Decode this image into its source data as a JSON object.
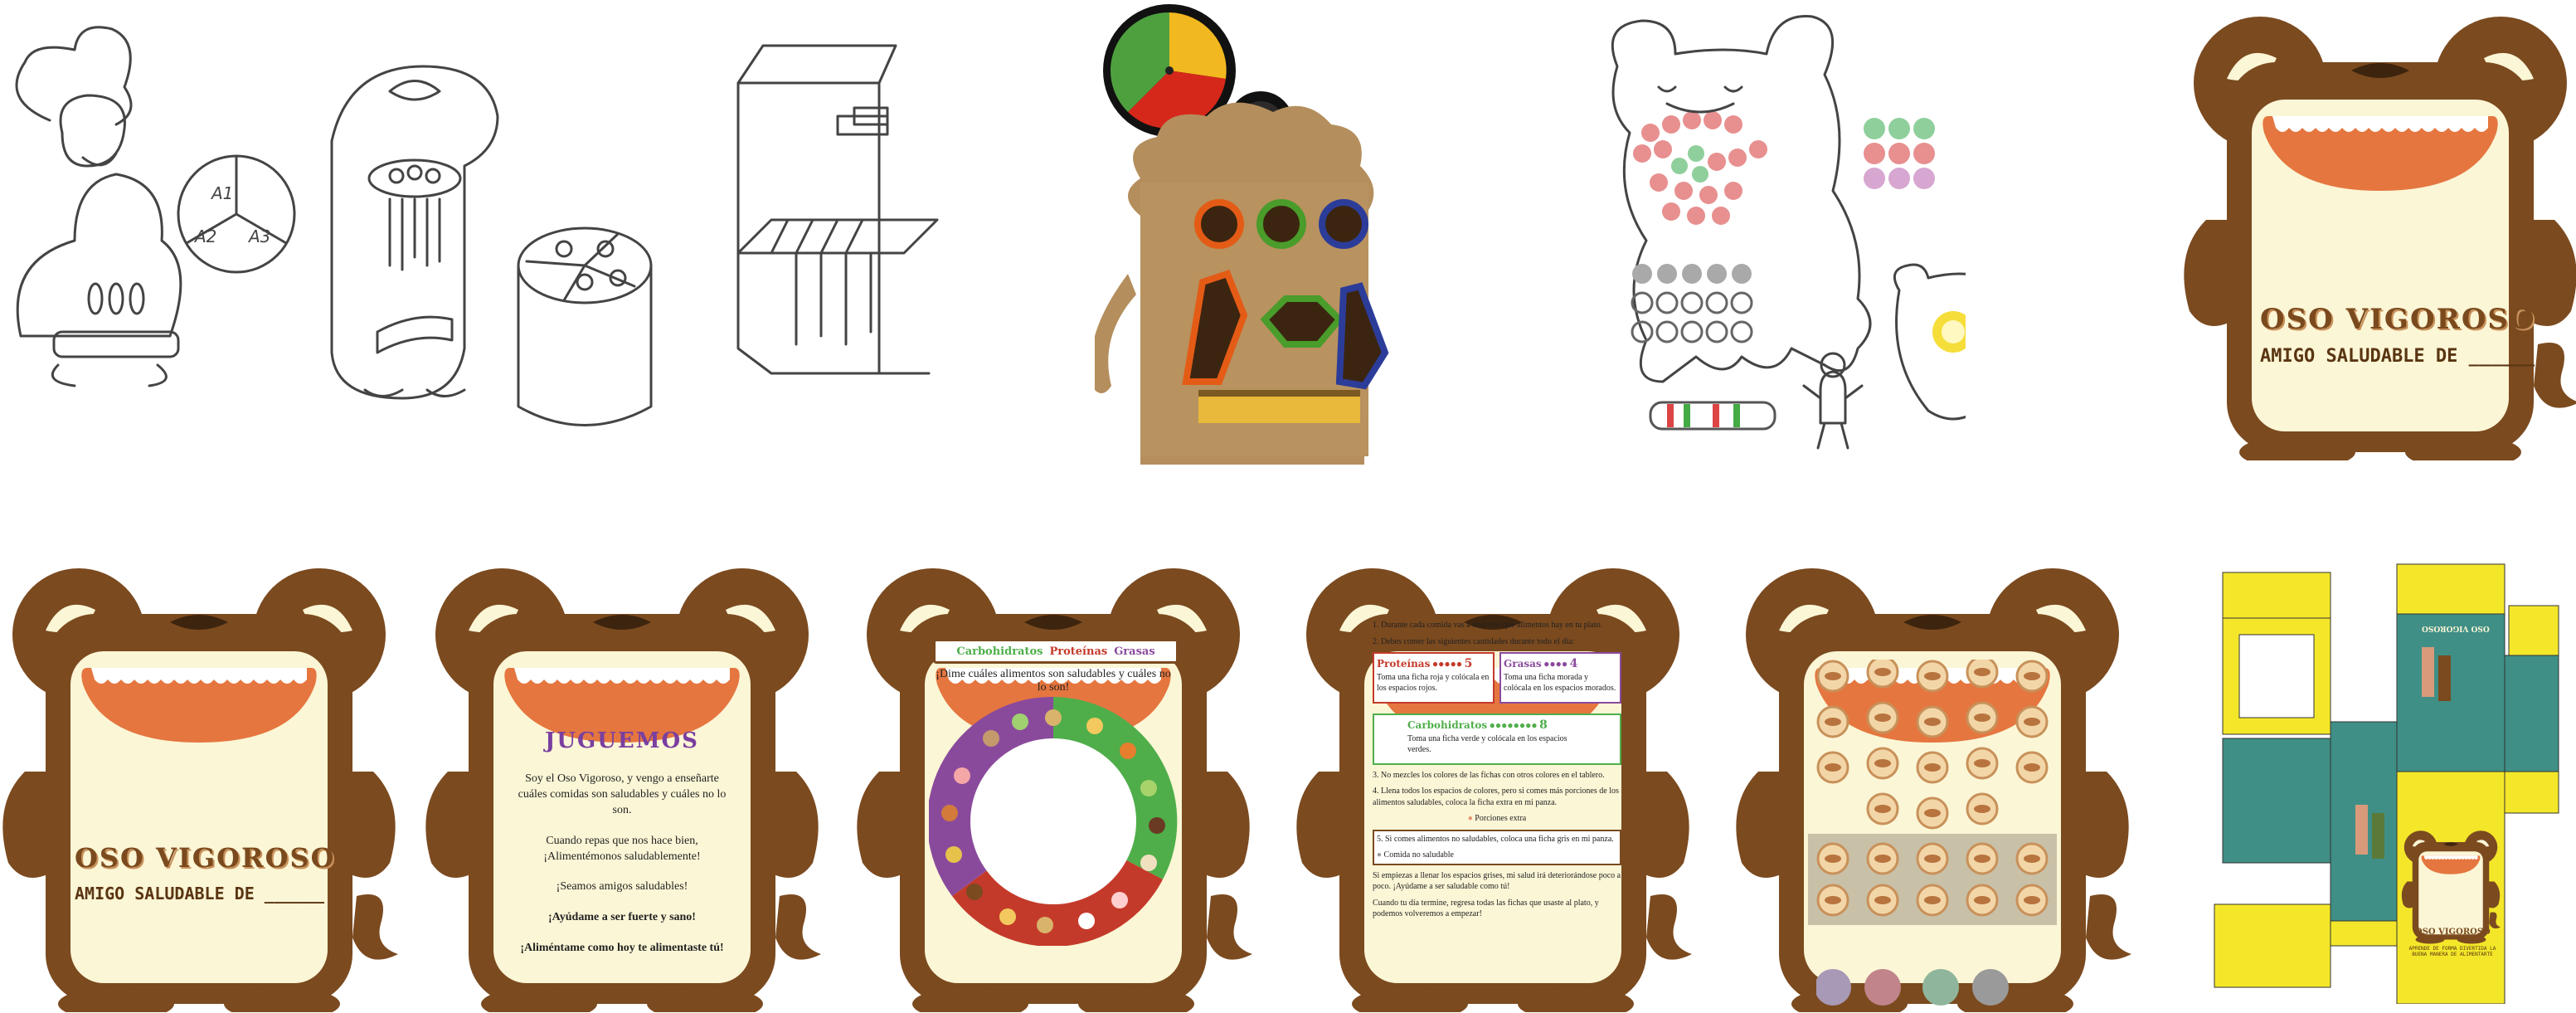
{
  "sketches": {
    "cube_labels": [
      "A1",
      "A2",
      "A3"
    ]
  },
  "cover": {
    "title": "OSO VIGOROSO",
    "subtitle": "AMIGO SALUDABLE DE ______"
  },
  "cover_small": {
    "title": "OSO VIGOROSO",
    "subtitle": "AMIGO SALUDABLE DE ______"
  },
  "juguemos": {
    "title": "JUGUEMOS",
    "p1": "Soy el Oso Vigoroso, y vengo a enseñarte cuáles comidas son saludables y cuáles no lo son.",
    "p2": "Cuando repas que nos hace bien, ¡Alimentémonos saludablemente!",
    "p3": "¡Seamos amigos saludables!",
    "p4": "¡Ayúdame a ser fuerte y sano!",
    "p5": "¡Aliméntame como hoy te alimentaste tú!"
  },
  "wheel": {
    "header_carb": "Carbohidratos",
    "header_prot": "Proteínas",
    "header_fat": "Grasas",
    "question": "¡Dime cuáles alimentos son saludables y cuáles no lo son!"
  },
  "instructions": {
    "step1": "1. Durante cada comida vas a observar que alimentos hay en tu plato.",
    "step2": "2. Debes comer las siguientes cantidades durante todo el día:",
    "proteinas_label": "Proteínas",
    "proteinas_count": "5",
    "proteinas_text": "Toma una ficha roja y colócala en los espacios rojos.",
    "grasas_label": "Grasas",
    "grasas_count": "4",
    "grasas_text": "Toma una ficha morada y colócala en los espacios morados.",
    "carb_label": "Carbohidratos",
    "carb_count": "8",
    "carb_text": "Toma una ficha verde y colócala en los espacios verdes.",
    "step3": "3. No mezcles los colores de las fichas con otros colores en el tablero.",
    "step4": "4. Llena todos los espacios de colores, pero si comes más porciones de los alimentos saludables, coloca la ficha extra en mi panza.",
    "porciones_extra": "Porciones extra",
    "step5": "5. Si comes alimentos no saludables, coloca una ficha gris en mi panza.",
    "comida_no_saludable": "Comida no saludable",
    "footer1": "Si empiezas a llenar los espacios grises, mi salud irá deteriorándose poco a poco. ¡Ayúdame a ser saludable como tú!",
    "footer2": "Cuando tu día termine, regresa todas las fichas que usaste al plato, y podemos volveremos a empezar!"
  },
  "box_template": {
    "title": "OSO VIGOROSO",
    "subtitle": "APRENDE DE FORMA DIVERTIDA LA BUENA MANERA DE ALIMENTARTE",
    "side_text": "OSO VIGOROSO"
  },
  "colors": {
    "bear_brown": "#7b4a1f",
    "belly_cream": "#fbf6d6",
    "mouth_orange": "#e5763f",
    "carb_green": "#4fae4a",
    "prot_red": "#c43a2a",
    "fat_purple": "#8a4a9c",
    "chip_purple": "#a899b6",
    "chip_red": "#c0848a",
    "chip_green": "#8fb69c",
    "chip_gray": "#9a9a9a",
    "box_yellow": "#f4e72a",
    "box_teal": "#3f8f86"
  }
}
